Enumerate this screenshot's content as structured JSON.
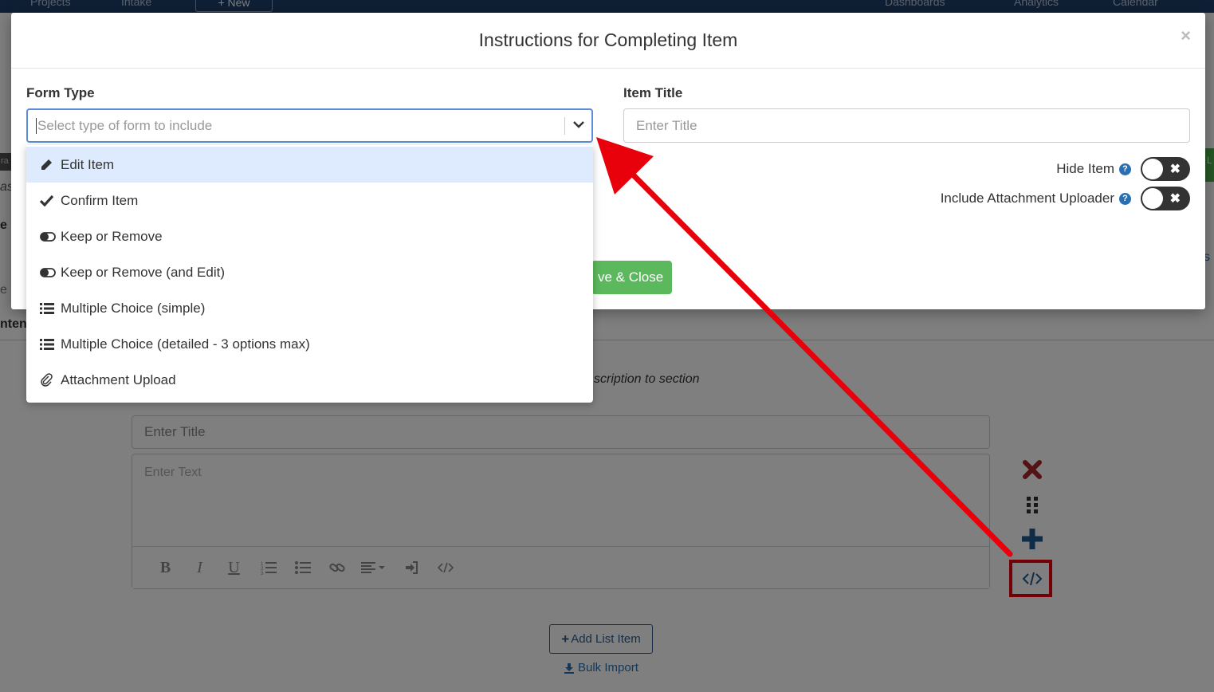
{
  "nav": {
    "projects_label": "Projects",
    "intake_label": "Intake",
    "new_label": "+ New",
    "dashboards_label": "Dashboards",
    "analytics_label": "Analytics",
    "calendar_label": "Calendar"
  },
  "background": {
    "section_description_hint": "scription to section",
    "content_stub": "nten",
    "title_placeholder": "Enter Title",
    "text_placeholder": "Enter Text",
    "add_list_item_label": "Add List Item",
    "bulk_import_label": "Bulk Import"
  },
  "modal": {
    "title": "Instructions for Completing Item",
    "close_label": "×",
    "form_type_label": "Form Type",
    "form_type_placeholder": "Select type of form to include",
    "item_title_label": "Item Title",
    "item_title_placeholder": "Enter Title",
    "hide_item_label": "Hide Item",
    "include_attachment_label": "Include Attachment Uploader",
    "save_close_label": "ve & Close"
  },
  "dropdown": {
    "options": [
      {
        "label": "Edit Item",
        "icon": "pencil-icon",
        "active": true
      },
      {
        "label": "Confirm Item",
        "icon": "checkmark-icon"
      },
      {
        "label": "Keep or Remove",
        "icon": "toggle-icon"
      },
      {
        "label": "Keep or Remove (and Edit)",
        "icon": "toggle-icon"
      },
      {
        "label": "Multiple Choice (simple)",
        "icon": "list-icon"
      },
      {
        "label": "Multiple Choice (detailed - 3 options max)",
        "icon": "list-icon"
      },
      {
        "label": "Attachment Upload",
        "icon": "paperclip-icon"
      }
    ]
  },
  "colors": {
    "annotation_red": "#e8000b",
    "primary_blue": "#2a6fb0",
    "success_green": "#5cb85c",
    "delete_red": "#a82828"
  }
}
